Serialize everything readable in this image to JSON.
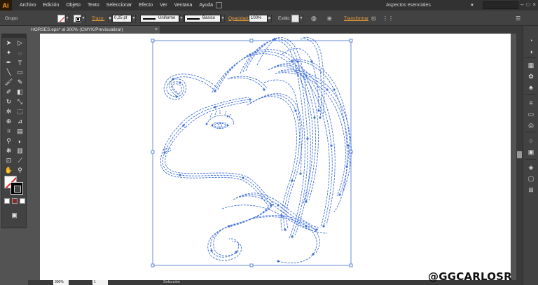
{
  "app": {
    "logo": "Ai"
  },
  "menu": [
    "Archivo",
    "Edición",
    "Objeto",
    "Texto",
    "Seleccionar",
    "Efecto",
    "Ver",
    "Ventana",
    "Ayuda"
  ],
  "workspace": {
    "label": "Aspectos esenciales"
  },
  "control_bar": {
    "group_label": "Grupo",
    "stroke_label": "Trazo:",
    "stroke_weight": "0,25 pt",
    "profile_label": "Uniforme",
    "brush_label": "Básico",
    "opacity_label": "Opacidad:",
    "opacity_value": "100%",
    "style_label": "Estilo:",
    "transform_label": "Transformar"
  },
  "document": {
    "tab_title": "HORSES.eps* al 300% (CMYK/Previsualizar)",
    "close": "×"
  },
  "status_bar": {
    "zoom": "300%",
    "page": "1",
    "status": "Selección"
  },
  "watermark": "@GGCARLOSR",
  "icons": {
    "tools": [
      "selection-icon",
      "direct-selection-icon",
      "magic-wand-icon",
      "lasso-icon",
      "pen-icon",
      "type-icon",
      "line-icon",
      "rectangle-icon",
      "paintbrush-icon",
      "pencil-icon",
      "blob-brush-icon",
      "eraser-icon",
      "rotate-icon",
      "scale-icon",
      "warp-icon",
      "free-transform-icon",
      "shape-builder-icon",
      "perspective-grid-icon",
      "mesh-icon",
      "gradient-icon",
      "eyedropper-icon",
      "blend-icon",
      "symbol-sprayer-icon",
      "graph-icon",
      "artboard-icon",
      "slice-icon",
      "hand-icon",
      "zoom-icon"
    ],
    "dock": [
      "color-panel-icon",
      "color-guide-icon",
      "swatches-icon",
      "brushes-icon",
      "symbols-icon",
      "stroke-icon",
      "gradient-panel-icon",
      "transparency-icon",
      "appearance-icon",
      "graphic-styles-icon",
      "layers-icon",
      "artboards-panel-icon"
    ]
  },
  "colors": {
    "accent": "#f0a33a",
    "path_blue": "#3f6fd8",
    "canvas": "#535353",
    "artboard": "#ffffff"
  }
}
